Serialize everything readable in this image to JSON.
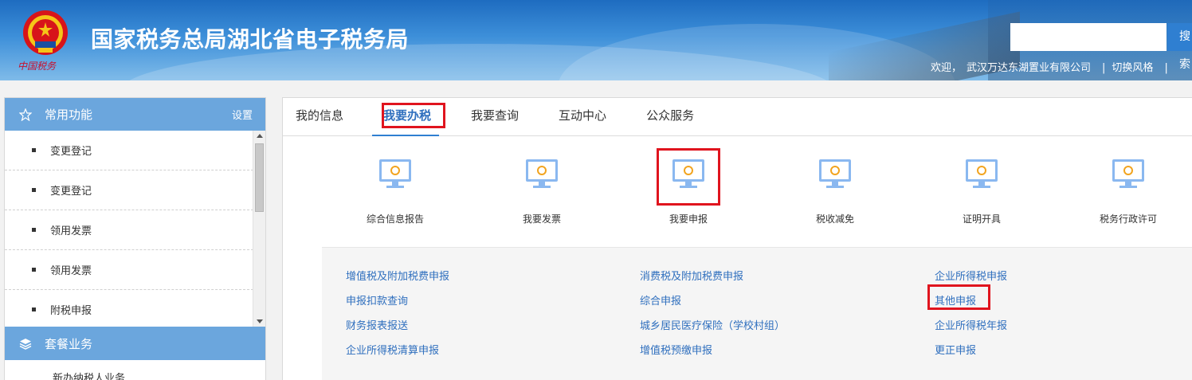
{
  "header": {
    "site_title": "国家税务总局湖北省电子税务局",
    "emblem_text": "中国税务",
    "search_button": "搜索",
    "search_placeholder": "",
    "welcome": "欢迎，",
    "company": "武汉万达东湖置业有限公司",
    "switch_style": "切换风格"
  },
  "sidebar": {
    "common_title": "常用功能",
    "settings": "设置",
    "items": [
      {
        "label": "变更登记"
      },
      {
        "label": "变更登记"
      },
      {
        "label": "领用发票"
      },
      {
        "label": "领用发票"
      },
      {
        "label": "附税申报"
      }
    ],
    "package_title": "套餐业务",
    "package_first_item": "新办纳税人业务"
  },
  "tabs": [
    {
      "label": "我的信息"
    },
    {
      "label": "我要办税",
      "active": true
    },
    {
      "label": "我要查询"
    },
    {
      "label": "互动中心"
    },
    {
      "label": "公众服务"
    }
  ],
  "functions": [
    {
      "label": "综合信息报告",
      "icon": "monitor-icon"
    },
    {
      "label": "我要发票",
      "icon": "monitor-icon"
    },
    {
      "label": "我要申报",
      "icon": "monitor-icon"
    },
    {
      "label": "税收减免",
      "icon": "monitor-icon"
    },
    {
      "label": "证明开具",
      "icon": "monitor-icon"
    },
    {
      "label": "税务行政许可",
      "icon": "monitor-icon"
    }
  ],
  "submenu": {
    "col1": [
      "增值税及附加税费申报",
      "申报扣款查询",
      "财务报表报送",
      "企业所得税清算申报"
    ],
    "col2": [
      "消费税及附加税费申报",
      "综合申报",
      "城乡居民医疗保险（学校村组）",
      "增值税预缴申报"
    ],
    "col3": [
      "企业所得税申报",
      "其他申报",
      "企业所得税年报",
      "更正申报"
    ]
  },
  "colors": {
    "accent": "#2f7fd1",
    "sidebar_header": "#6ba6dd",
    "highlight": "#e0141e",
    "link": "#2f6fbe"
  }
}
